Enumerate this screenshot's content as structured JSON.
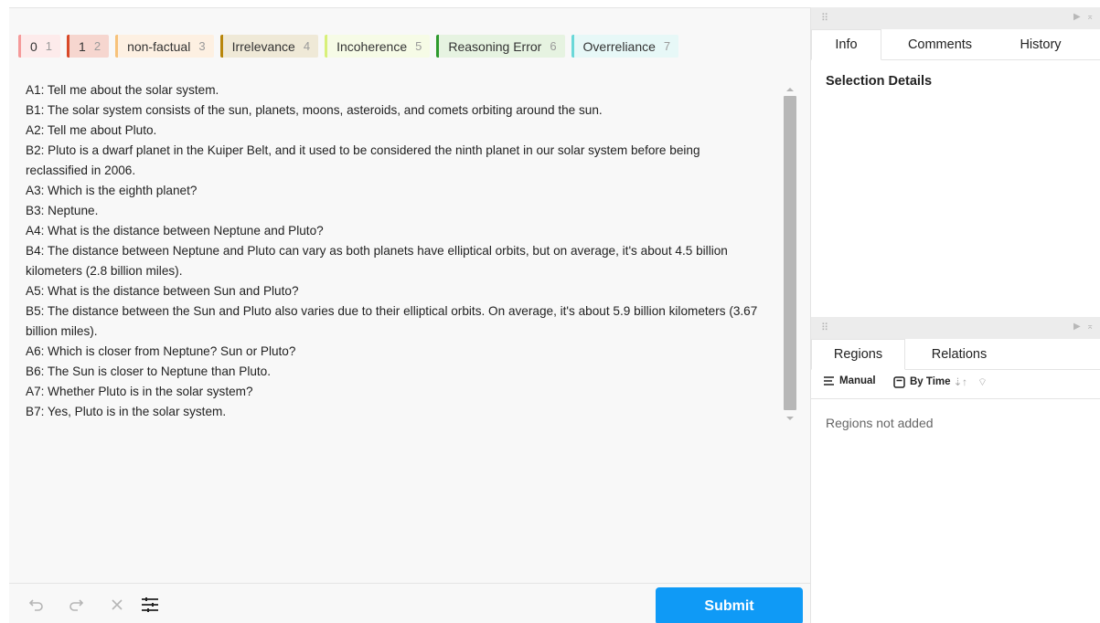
{
  "labels": [
    {
      "name": "0",
      "hotkey": "1",
      "color": "#f59a9a",
      "bg": "#fdebeb"
    },
    {
      "name": "1",
      "hotkey": "2",
      "color": "#d84a2a",
      "bg": "#f6d6cf"
    },
    {
      "name": "non-factual",
      "hotkey": "3",
      "color": "#f7c27a",
      "bg": "#fdf0e2"
    },
    {
      "name": "Irrelevance",
      "hotkey": "4",
      "color": "#b8860b",
      "bg": "#efe9d7"
    },
    {
      "name": "Incoherence",
      "hotkey": "5",
      "color": "#d8f07a",
      "bg": "#f6fbe6"
    },
    {
      "name": "Reasoning Error",
      "hotkey": "6",
      "color": "#2e9a2e",
      "bg": "#e6f3e1"
    },
    {
      "name": "Overreliance",
      "hotkey": "7",
      "color": "#6ad8d8",
      "bg": "#e7f8f7"
    }
  ],
  "text_lines": [
    "A1: Tell me about the solar system.",
    "B1: The solar system consists of the sun, planets, moons, asteroids, and comets orbiting around the sun.",
    "A2: Tell me about Pluto.",
    "B2: Pluto is a dwarf planet in the Kuiper Belt, and it used to be considered the ninth planet in our solar system before being",
    "reclassified in 2006.",
    "A3: Which is the eighth planet?",
    "B3: Neptune.",
    "A4: What is the distance between Neptune and Pluto?",
    "B4: The distance between Neptune and Pluto can vary as both planets have elliptical orbits, but on average, it's about 4.5 billion",
    "kilometers (2.8 billion miles).",
    "A5: What is the distance between Sun and Pluto?",
    "B5: The distance between the Sun and Pluto also varies due to their elliptical orbits. On average, it's about 5.9 billion kilometers (3.67",
    "billion miles).",
    "A6: Which is closer from Neptune? Sun or Pluto?",
    "B6: The Sun is closer to Neptune than Pluto.",
    "A7: Whether Pluto is in the solar system?",
    "B7: Yes, Pluto is in the solar system."
  ],
  "toolbar": {
    "undo_icon": "undo-icon",
    "redo_icon": "redo-icon",
    "reset_icon": "close-icon",
    "settings_icon": "sliders-icon",
    "submit_label": "Submit"
  },
  "info_panel": {
    "tabs": [
      "Info",
      "Comments",
      "History"
    ],
    "active_tab": "Info",
    "section_title": "Selection Details"
  },
  "regions_panel": {
    "tabs": [
      "Regions",
      "Relations"
    ],
    "active_tab": "Regions",
    "group_manual": "Manual",
    "sort_label": "By Time",
    "empty_message": "Regions not added"
  }
}
